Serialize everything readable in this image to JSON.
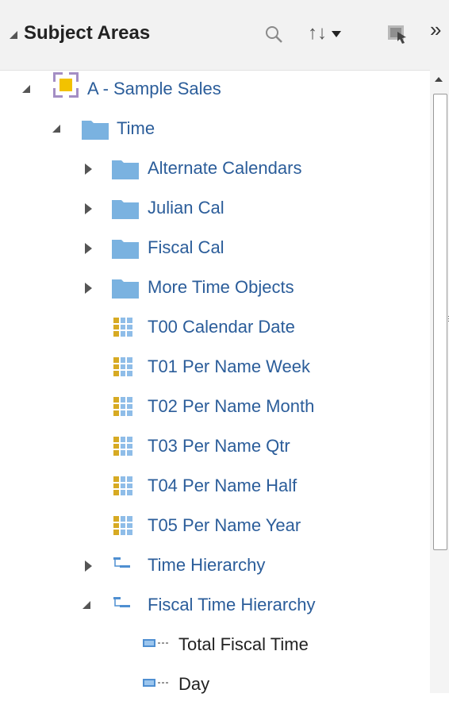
{
  "header": {
    "title": "Subject Areas",
    "sort_glyph": "↑↓",
    "more_glyph": "»"
  },
  "colors": {
    "link": "#2b5d9a",
    "folder": "#7ab2e0",
    "header_bg": "#f2f2f2"
  },
  "icons": {
    "subject_area": "subject-area-icon",
    "folder": "folder-icon",
    "table": "table-icon",
    "hierarchy": "hierarchy-icon",
    "level": "level-icon"
  },
  "tree": {
    "root": "A - Sample Sales",
    "time": "Time",
    "children": [
      "Alternate Calendars",
      "Julian Cal",
      "Fiscal Cal",
      "More Time Objects",
      "T00 Calendar Date",
      "T01 Per Name Week",
      "T02 Per Name Month",
      "T03 Per Name Qtr",
      "T04 Per Name Half",
      "T05 Per Name Year",
      "Time Hierarchy",
      "Fiscal Time Hierarchy"
    ],
    "levels": [
      "Total Fiscal Time",
      "Day"
    ]
  }
}
